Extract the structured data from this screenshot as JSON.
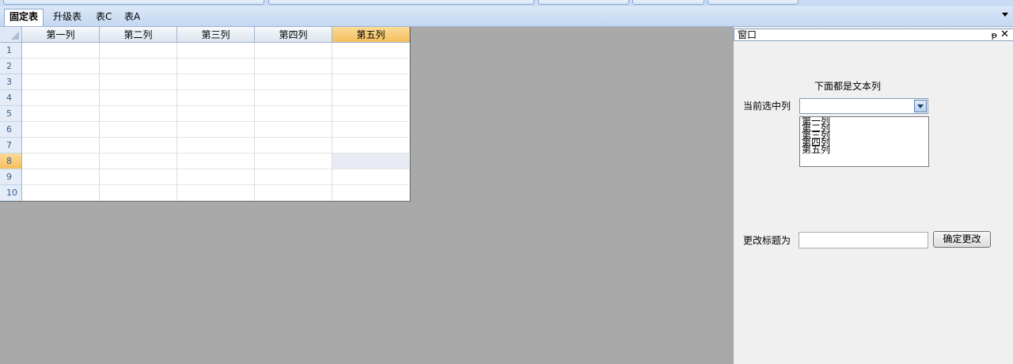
{
  "tabs": [
    {
      "label": "固定表",
      "active": true
    },
    {
      "label": "升级表",
      "active": false
    },
    {
      "label": "表C",
      "active": false
    },
    {
      "label": "表A",
      "active": false
    }
  ],
  "grid": {
    "columns": [
      "第一列",
      "第二列",
      "第三列",
      "第四列",
      "第五列"
    ],
    "selected_column": "第五列",
    "rows": [
      "1",
      "2",
      "3",
      "4",
      "5",
      "6",
      "7",
      "8",
      "9",
      "10"
    ],
    "selected_row": "8"
  },
  "panel": {
    "caption": "窗口",
    "pin_glyph": "ᵽ",
    "close_glyph": "✕",
    "note": "下面都是文本列",
    "current_column_label": "当前选中列",
    "current_column_value": "",
    "column_options": [
      "第一列",
      "第二列",
      "第三列",
      "第四列",
      "第五列"
    ],
    "rename_label": "更改标题为",
    "rename_value": "",
    "confirm_label": "确定更改"
  }
}
